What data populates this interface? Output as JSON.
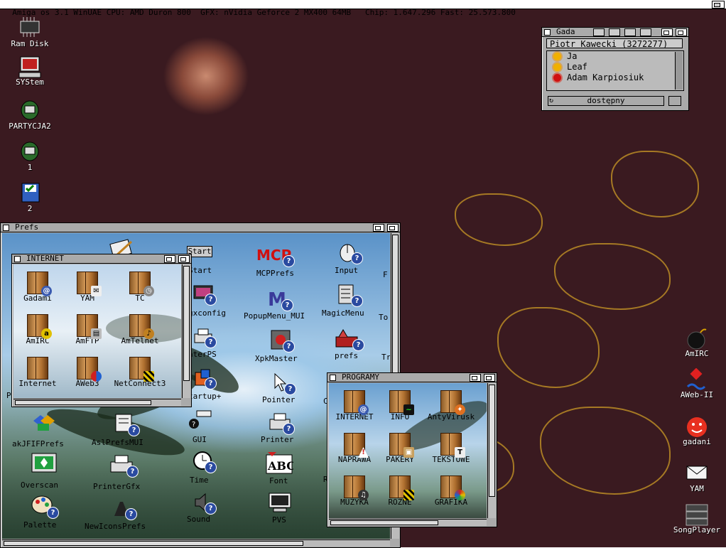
{
  "screen": {
    "title": "Amiga os 3.1 WinUAE CPU: AMD Duron 800  GFX: nVidia Geforce 2 MX400 64MB   Chip: 1.647.296 Fast: 25.573.800"
  },
  "desktop_left": [
    {
      "label": "Ram Disk",
      "icon": "ram-chip-icon"
    },
    {
      "label": "SYStem",
      "icon": "computer-icon"
    },
    {
      "label": "PARTYCJA2",
      "icon": "hard-disk-icon"
    },
    {
      "label": "1",
      "icon": "hard-disk-icon"
    },
    {
      "label": "2",
      "icon": "floppy-check-icon"
    }
  ],
  "desktop_right": [
    {
      "label": "AmIRC",
      "icon": "bomb-icon"
    },
    {
      "label": "AWeb-II",
      "icon": "aweb-logo-icon"
    },
    {
      "label": "gadani",
      "icon": "face-icon"
    },
    {
      "label": "YAM",
      "icon": "envelope-icon"
    },
    {
      "label": "SongPlayer",
      "icon": "hifi-icon"
    }
  ],
  "gada": {
    "title": "Gada",
    "user": "Piotr Kawecki (3272277)",
    "contacts": [
      "Ja",
      "Leaf",
      "Adam Karpiosiuk"
    ],
    "status": "dostępny",
    "colors": {
      "online": "#f0b000",
      "busy": "#d01010"
    }
  },
  "prefs": {
    "title": "Prefs",
    "col3": [
      "Start",
      "gxconfig",
      "nterPS",
      "tartup+",
      "GUI",
      "Time",
      "Sound"
    ],
    "col4": [
      "MCPPrefs",
      "PopupMenu_MUI",
      "XpkMaster",
      "Pointer",
      "Printer",
      "Font",
      "PVS"
    ],
    "col5": [
      "Input",
      "MagicMenu",
      "prefs"
    ],
    "col6": [
      "F",
      "To",
      "Tr"
    ],
    "bottom_col1": [
      "akJFIFPrefs",
      "Overscan",
      "Palette"
    ],
    "bottom_col2": [
      "AslPrefsMUI",
      "PrinterGfx",
      "NewIconsPrefs"
    ],
    "partial_p": [
      "P",
      "P"
    ],
    "start_button": "Start",
    "r_labels": [
      "C",
      "R"
    ]
  },
  "internet": {
    "title": "INTERNET",
    "items": [
      "Gadami",
      "YAM",
      "TC",
      "AmIRC",
      "AmFTP",
      "AmTelnet",
      "Internet",
      "AWeb3",
      "NetConnect3"
    ]
  },
  "programy": {
    "title": "PROGRAMY",
    "items": [
      "INTERNET",
      "INFO",
      "AntyVirusk",
      "NAPRAWA",
      "PAKERY",
      "TEKSTOWE",
      "MUZYKA",
      "ROZNE",
      "GRAFIKA"
    ]
  }
}
